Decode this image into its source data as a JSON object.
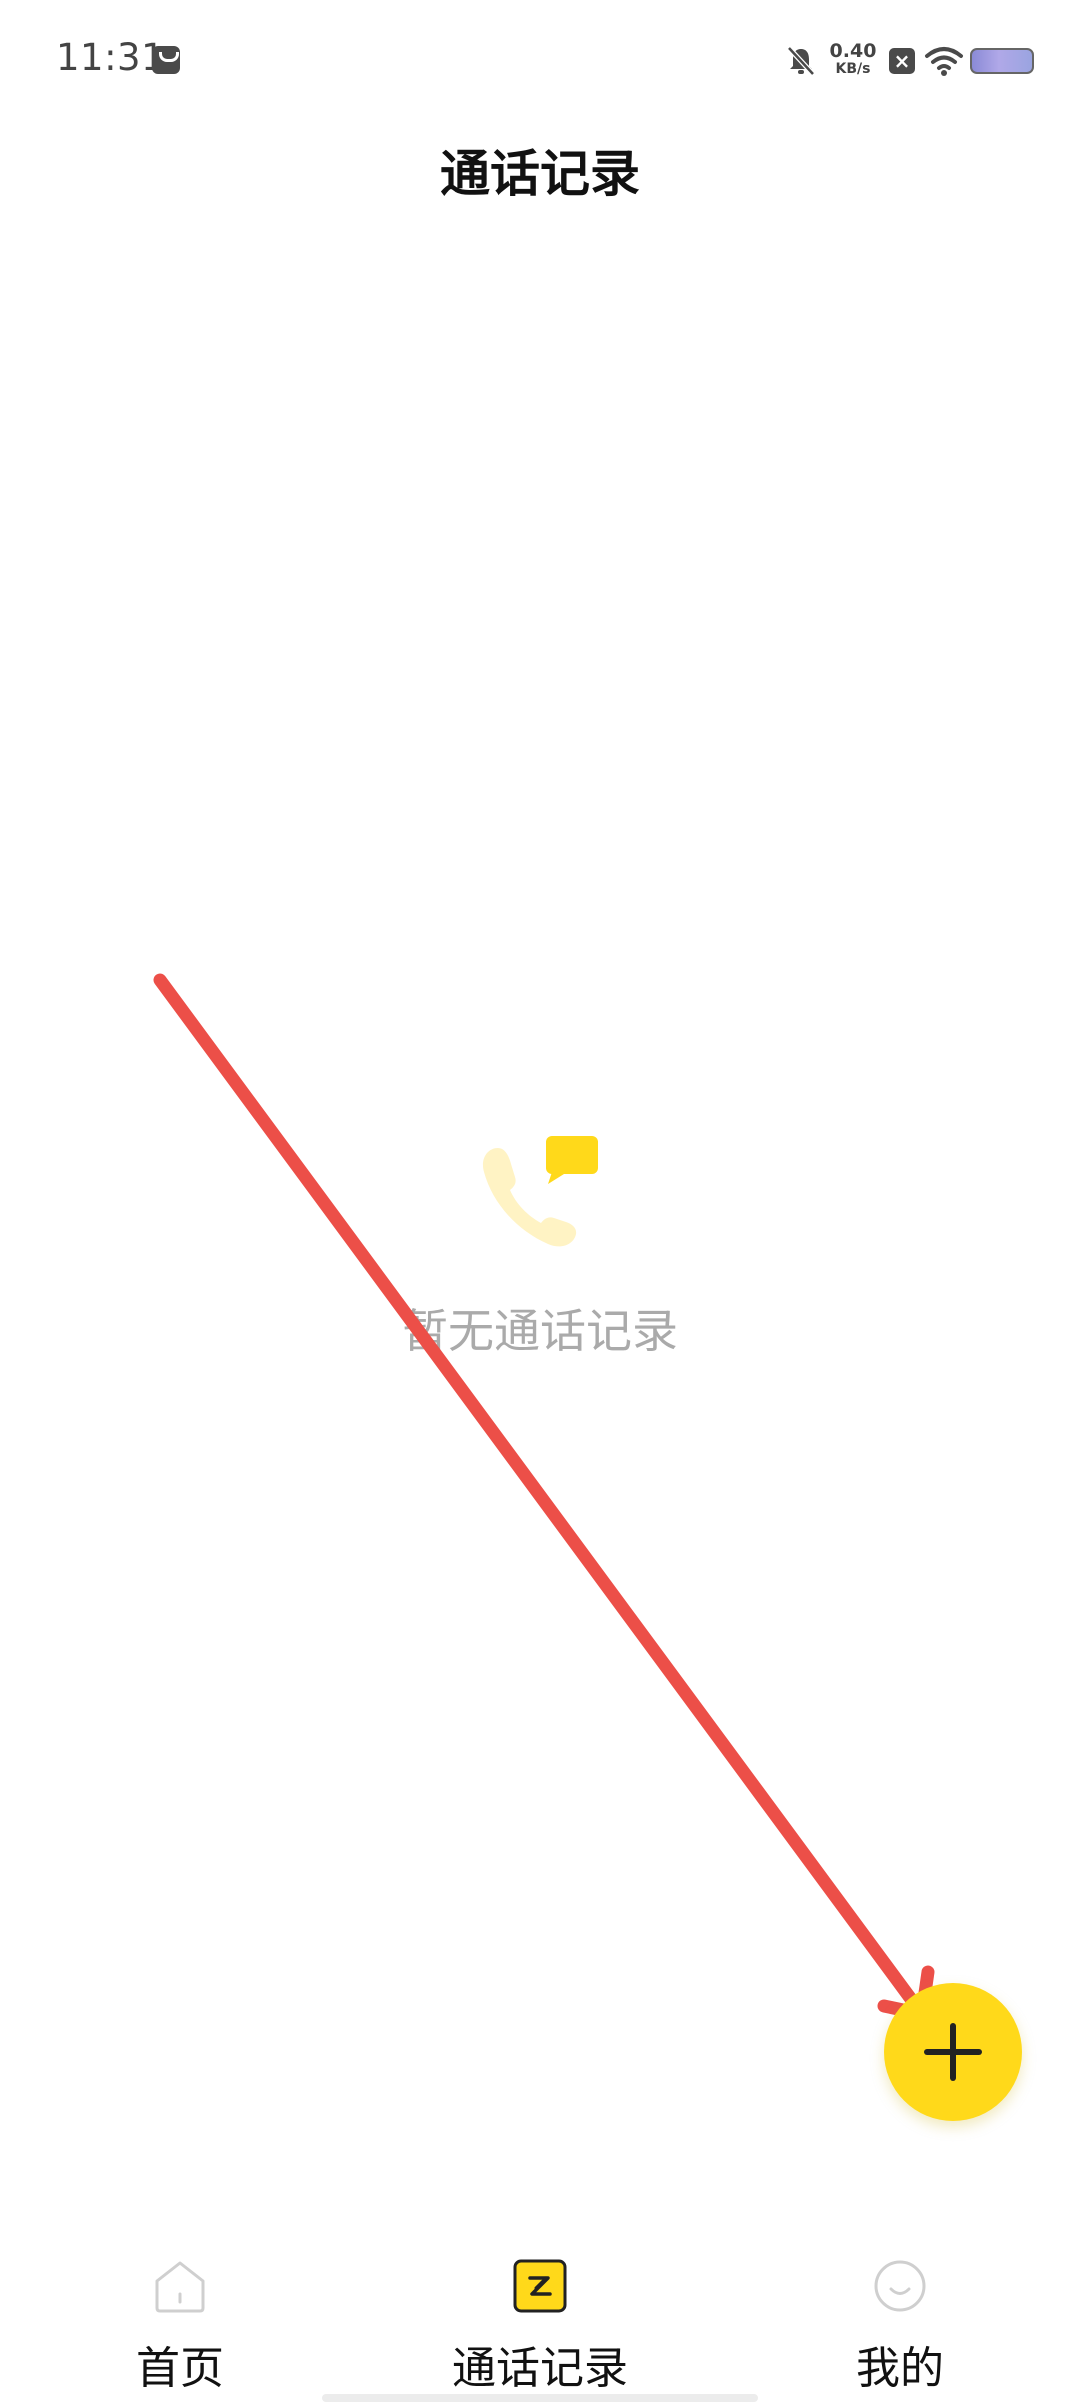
{
  "status_bar": {
    "time": "11:31",
    "net_speed_value": "0.40",
    "net_speed_unit": "KB/s",
    "icons": [
      "shopping-bag-icon",
      "bell-off-icon",
      "sim-off-icon",
      "wifi-icon",
      "battery-icon"
    ]
  },
  "header": {
    "title": "通话记录"
  },
  "empty_state": {
    "icon": "phone-chat-icon",
    "message": "暂无通话记录"
  },
  "fab": {
    "icon": "plus-icon",
    "color": "#FFD91A"
  },
  "bottom_nav": {
    "items": [
      {
        "label": "首页",
        "icon": "home-icon",
        "active": false
      },
      {
        "label": "通话记录",
        "icon": "call-log-icon",
        "active": true
      },
      {
        "label": "我的",
        "icon": "smiley-icon",
        "active": false
      }
    ]
  },
  "colors": {
    "accent": "#FFD91A",
    "annotation_arrow": "#EC4F48",
    "muted_text": "#AAAAAA"
  }
}
